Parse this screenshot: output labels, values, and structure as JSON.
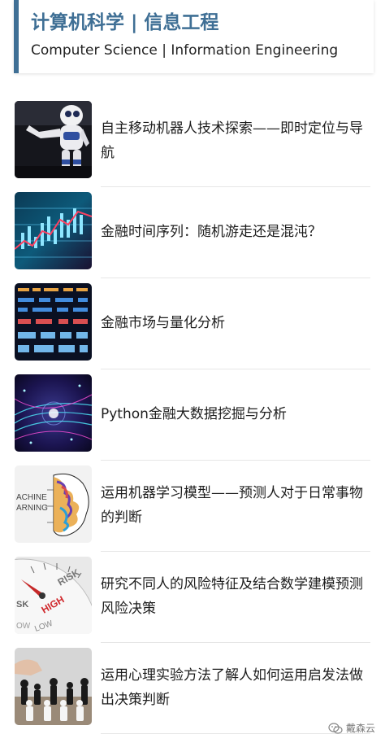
{
  "header": {
    "title": "计算机科学 | 信息工程",
    "subtitle": "Computer Science | Information Engineering",
    "accent": "#3f6f95"
  },
  "articles": [
    {
      "title": "自主移动机器人技术探索——即时定位与导航",
      "thumbnail": "robot-image"
    },
    {
      "title": "金融时间序列：随机游走还是混沌？",
      "thumbnail": "finance-chart-image"
    },
    {
      "title": "金融市场与量化分析",
      "thumbnail": "stock-ticker-image"
    },
    {
      "title": "Python金融大数据挖掘与分析",
      "thumbnail": "data-network-image"
    },
    {
      "title": "运用机器学习模型——预测人对于日常事物的判断",
      "thumbnail": "machine-learning-brain-image",
      "thumb_text": [
        "ACHINE",
        "ARNING"
      ]
    },
    {
      "title": "研究不同人的风险特征及结合数学建模预测风险决策",
      "thumbnail": "risk-gauge-image",
      "thumb_text": [
        "RISK",
        "HIGH",
        "SK",
        "LOW",
        "OW"
      ]
    },
    {
      "title": "运用心理实验方法了解人如何运用启发法做出决策判断",
      "thumbnail": "chess-image"
    }
  ],
  "watermark": {
    "text": "戴森云",
    "icon": "wechat-icon"
  }
}
